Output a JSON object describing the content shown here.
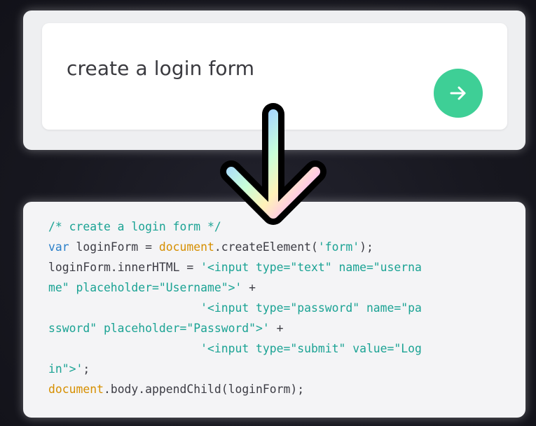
{
  "prompt": {
    "text": "create a login form",
    "submit_icon": "arrow-right-icon",
    "button_color": "#3ecf96"
  },
  "decoration": {
    "icon": "arrow-down-icon"
  },
  "code": {
    "lines": [
      [
        {
          "t": "comment",
          "v": "/* create a login form */"
        }
      ],
      [
        {
          "t": "keyword",
          "v": "var"
        },
        {
          "t": "plain",
          "v": " loginForm = "
        },
        {
          "t": "global",
          "v": "document"
        },
        {
          "t": "plain",
          "v": ".createElement("
        },
        {
          "t": "string",
          "v": "'form'"
        },
        {
          "t": "plain",
          "v": ");"
        }
      ],
      [
        {
          "t": "plain",
          "v": "loginForm.innerHTML = "
        },
        {
          "t": "string",
          "v": "'<input type=\"text\" name=\"userna"
        }
      ],
      [
        {
          "t": "string",
          "v": "me\" placeholder=\"Username\">'"
        },
        {
          "t": "plain",
          "v": " +"
        }
      ],
      [
        {
          "t": "plain",
          "v": "                      "
        },
        {
          "t": "string",
          "v": "'<input type=\"password\" name=\"pa"
        }
      ],
      [
        {
          "t": "string",
          "v": "ssword\" placeholder=\"Password\">'"
        },
        {
          "t": "plain",
          "v": " +"
        }
      ],
      [
        {
          "t": "plain",
          "v": "                      "
        },
        {
          "t": "string",
          "v": "'<input type=\"submit\" value=\"Log"
        }
      ],
      [
        {
          "t": "string",
          "v": "in\">'"
        },
        {
          "t": "plain",
          "v": ";"
        }
      ],
      [
        {
          "t": "global",
          "v": "document"
        },
        {
          "t": "plain",
          "v": ".body.appendChild(loginForm);"
        }
      ]
    ]
  }
}
